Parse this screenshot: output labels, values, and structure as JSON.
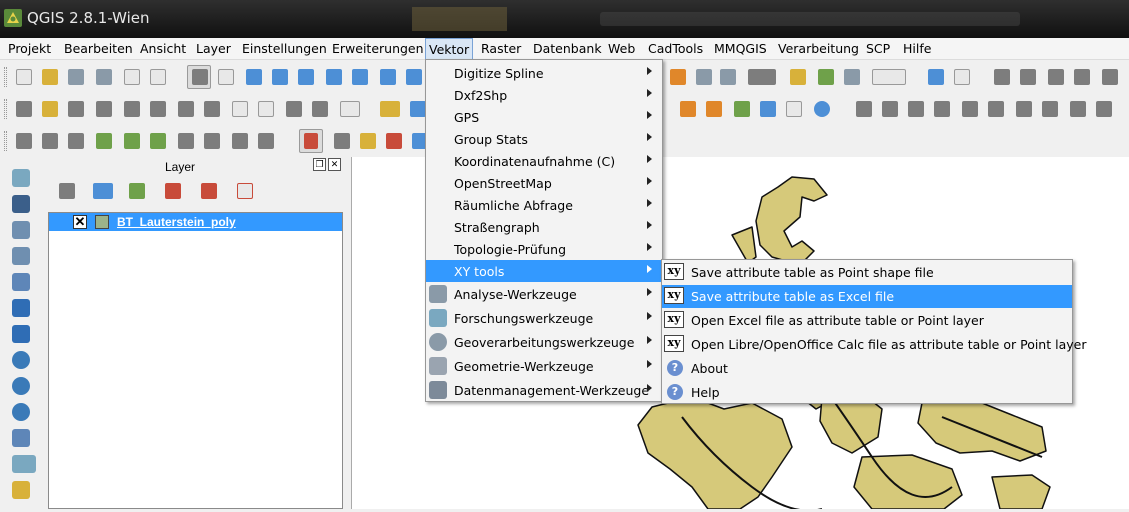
{
  "window": {
    "title": "QGIS 2.8.1-Wien"
  },
  "menubar": {
    "items": [
      "Projekt",
      "Bearbeiten",
      "Ansicht",
      "Layer",
      "Einstellungen",
      "Erweiterungen",
      "Vektor",
      "Raster",
      "Datenbank",
      "Web",
      "CadTools",
      "MMQGIS",
      "Verarbeitung",
      "SCP",
      "Hilfe"
    ],
    "active": "Vektor"
  },
  "vektor_menu": {
    "items": [
      "Digitize Spline",
      "Dxf2Shp",
      "GPS",
      "Group Stats",
      "Koordinatenaufnahme (C)",
      "OpenStreetMap",
      "Räumliche Abfrage",
      "Straßengraph",
      "Topologie-Prüfung",
      "XY tools",
      "Analyse-Werkzeuge",
      "Forschungswerkzeuge",
      "Geoverarbeitungswerkzeuge",
      "Geometrie-Werkzeuge",
      "Datenmanagement-Werkzeuge"
    ],
    "highlighted": "XY tools"
  },
  "xy_submenu": {
    "items": [
      "Save attribute table as Point shape file",
      "Save attribute table as Excel file",
      "Open Excel file as attribute table or Point layer",
      "Open Libre/OpenOffice Calc file as attribute table or Point layer",
      "About",
      "Help"
    ],
    "highlighted": "Save attribute table as Excel file",
    "xy_icon_text": "xy",
    "info_icon_text": "?"
  },
  "layer_panel": {
    "title": "Layer",
    "float_button": "❐",
    "close_button": "✕",
    "layers": [
      {
        "name": "BT_Lauterstein_poly",
        "visible": true,
        "check": "✕"
      }
    ]
  },
  "colors": {
    "selection": "#3399ff",
    "polygon_fill": "#d6c97a",
    "polygon_stroke": "#111111",
    "layer_swatch": "#9bb38a"
  }
}
